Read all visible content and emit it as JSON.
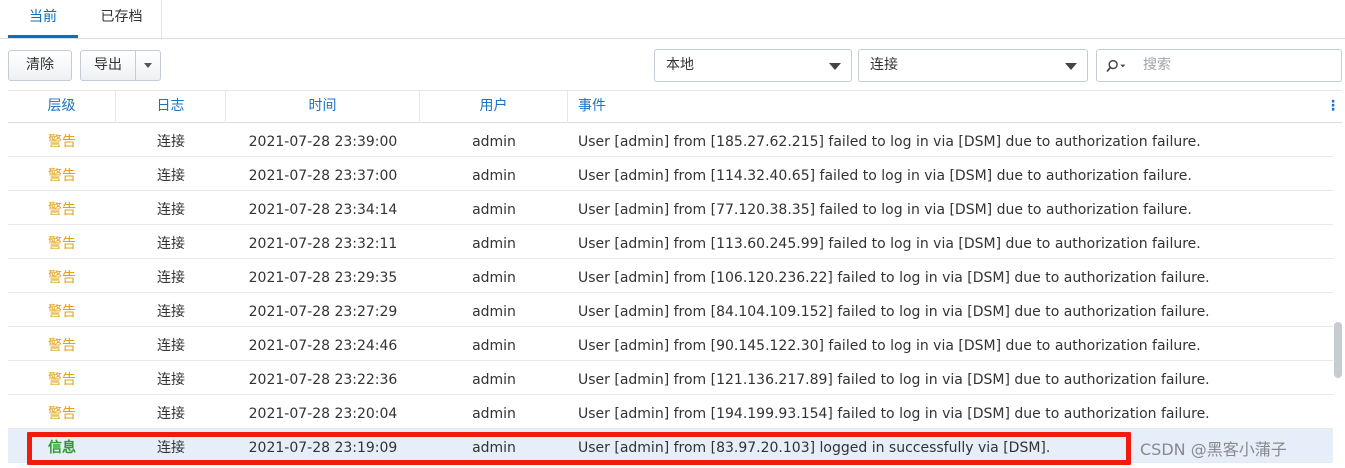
{
  "tabs": [
    {
      "label": "当前",
      "active": true
    },
    {
      "label": "已存档",
      "active": false
    }
  ],
  "toolbar": {
    "clear_label": "清除",
    "export_label": "导出",
    "location_select": "本地",
    "type_select": "连接",
    "search_placeholder": "搜索"
  },
  "columns": {
    "level": "层级",
    "log": "日志",
    "time": "时间",
    "user": "用户",
    "event": "事件"
  },
  "rows": [
    {
      "level": "警告",
      "log": "连接",
      "time": "2021-07-28 23:39:00",
      "user": "admin",
      "event": "User [admin] from [185.27.62.215] failed to log in via [DSM] due to authorization failure."
    },
    {
      "level": "警告",
      "log": "连接",
      "time": "2021-07-28 23:37:00",
      "user": "admin",
      "event": "User [admin] from [114.32.40.65] failed to log in via [DSM] due to authorization failure."
    },
    {
      "level": "警告",
      "log": "连接",
      "time": "2021-07-28 23:34:14",
      "user": "admin",
      "event": "User [admin] from [77.120.38.35] failed to log in via [DSM] due to authorization failure."
    },
    {
      "level": "警告",
      "log": "连接",
      "time": "2021-07-28 23:32:11",
      "user": "admin",
      "event": "User [admin] from [113.60.245.99] failed to log in via [DSM] due to authorization failure."
    },
    {
      "level": "警告",
      "log": "连接",
      "time": "2021-07-28 23:29:35",
      "user": "admin",
      "event": "User [admin] from [106.120.236.22] failed to log in via [DSM] due to authorization failure."
    },
    {
      "level": "警告",
      "log": "连接",
      "time": "2021-07-28 23:27:29",
      "user": "admin",
      "event": "User [admin] from [84.104.109.152] failed to log in via [DSM] due to authorization failure."
    },
    {
      "level": "警告",
      "log": "连接",
      "time": "2021-07-28 23:24:46",
      "user": "admin",
      "event": "User [admin] from [90.145.122.30] failed to log in via [DSM] due to authorization failure."
    },
    {
      "level": "警告",
      "log": "连接",
      "time": "2021-07-28 23:22:36",
      "user": "admin",
      "event": "User [admin] from [121.136.217.89] failed to log in via [DSM] due to authorization failure."
    },
    {
      "level": "警告",
      "log": "连接",
      "time": "2021-07-28 23:20:04",
      "user": "admin",
      "event": "User [admin] from [194.199.93.154] failed to log in via [DSM] due to authorization failure."
    },
    {
      "level": "信息",
      "log": "连接",
      "time": "2021-07-28 23:19:09",
      "user": "admin",
      "event": "User [admin] from [83.97.20.103] logged in successfully via [DSM]."
    }
  ],
  "watermark": "CSDN @黑客小蒲子",
  "colors": {
    "accent": "#0b6fbd",
    "header_text": "#1d72c4",
    "warning": "#e0a21b",
    "info": "#2e9b2e",
    "highlight_box": "#ee1c0e",
    "selected_row": "#e5eef9"
  },
  "icons": {
    "search": "search-icon",
    "dropdown": "chevron-down-icon",
    "column_menu": "kebab-menu-icon"
  }
}
